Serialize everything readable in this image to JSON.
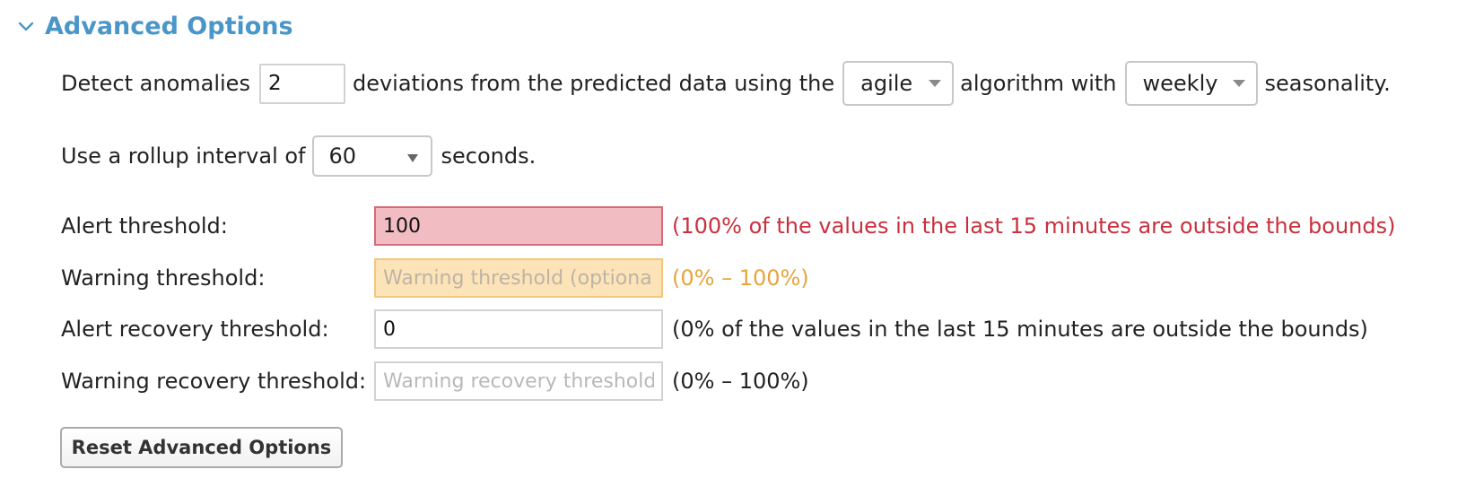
{
  "section": {
    "title": "Advanced Options",
    "chevron_icon": "chevron-down-icon",
    "accent_color": "#4a96c9"
  },
  "detect": {
    "prefix": "Detect anomalies",
    "deviations_value": "2",
    "middle": "deviations from the predicted data using the",
    "algorithm": "agile",
    "algorithm_suffix": "algorithm with",
    "seasonality": "weekly",
    "suffix": "seasonality."
  },
  "rollup": {
    "prefix": "Use a rollup interval of",
    "value": "60",
    "suffix": "seconds."
  },
  "thresholds": {
    "alert": {
      "label": "Alert threshold:",
      "value": "100",
      "placeholder": "",
      "note": "(100% of the values in the last 15 minutes are outside the bounds)",
      "note_color": "#c8303d"
    },
    "warning": {
      "label": "Warning threshold:",
      "value": "",
      "placeholder": "Warning threshold (optiona",
      "note": "(0% – 100%)",
      "note_color": "#e4a53d"
    },
    "alert_recovery": {
      "label": "Alert recovery threshold:",
      "value": "0",
      "placeholder": "",
      "note": "(0% of the values in the last 15 minutes are outside the bounds)"
    },
    "warning_recovery": {
      "label": "Warning recovery threshold:",
      "value": "",
      "placeholder": "Warning recovery threshold",
      "note": "(0% – 100%)"
    }
  },
  "reset_button": {
    "label": "Reset Advanced Options"
  }
}
